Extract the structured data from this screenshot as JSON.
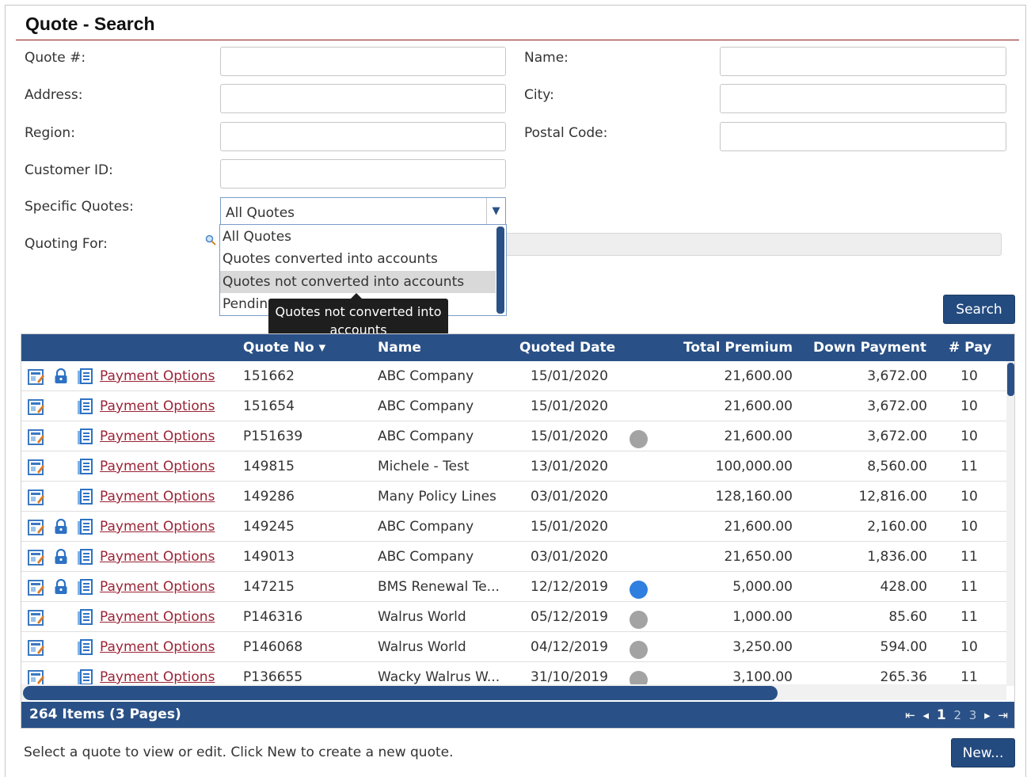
{
  "page": {
    "title": "Quote - Search"
  },
  "form": {
    "quote_no_label": "Quote #:",
    "name_label": "Name:",
    "address_label": "Address:",
    "city_label": "City:",
    "region_label": "Region:",
    "postal_code_label": "Postal Code:",
    "customer_id_label": "Customer ID:",
    "specific_quotes_label": "Specific Quotes:",
    "quoting_for_label": "Quoting For:",
    "specific_quotes_value": "All Quotes",
    "specific_quotes_options": [
      "All Quotes",
      "Quotes converted into accounts",
      "Quotes not converted into accounts",
      "Pending"
    ],
    "tooltip": "Quotes not converted into accounts",
    "search_label": "Search"
  },
  "grid": {
    "columns": {
      "quote_no": "Quote No",
      "name": "Name",
      "quoted_date": "Quoted Date",
      "total_premium": "Total Premium",
      "down_payment": "Down Payment",
      "pay": "# Pay"
    },
    "rows": [
      {
        "locked": true,
        "link": "Payment Options",
        "quote_no": "151662",
        "name": "ABC Company",
        "date": "15/01/2020",
        "status": "",
        "total": "21,600.00",
        "down": "3,672.00",
        "pay": "10"
      },
      {
        "locked": false,
        "link": "Payment Options",
        "quote_no": "151654",
        "name": "ABC Company",
        "date": "15/01/2020",
        "status": "",
        "total": "21,600.00",
        "down": "3,672.00",
        "pay": "10"
      },
      {
        "locked": false,
        "link": "Payment Options",
        "quote_no": "P151639",
        "name": "ABC Company",
        "date": "15/01/2020",
        "status": "grey",
        "total": "21,600.00",
        "down": "3,672.00",
        "pay": "10"
      },
      {
        "locked": false,
        "link": "Payment Options",
        "quote_no": "149815",
        "name": "Michele - Test",
        "date": "13/01/2020",
        "status": "",
        "total": "100,000.00",
        "down": "8,560.00",
        "pay": "11"
      },
      {
        "locked": false,
        "link": "Payment Options",
        "quote_no": "149286",
        "name": "Many Policy Lines",
        "date": "03/01/2020",
        "status": "",
        "total": "128,160.00",
        "down": "12,816.00",
        "pay": "10"
      },
      {
        "locked": true,
        "link": "Payment Options",
        "quote_no": "149245",
        "name": "ABC Company",
        "date": "15/01/2020",
        "status": "",
        "total": "21,600.00",
        "down": "2,160.00",
        "pay": "10"
      },
      {
        "locked": true,
        "link": "Payment Options",
        "quote_no": "149013",
        "name": "ABC Company",
        "date": "03/01/2020",
        "status": "",
        "total": "21,650.00",
        "down": "1,836.00",
        "pay": "11"
      },
      {
        "locked": true,
        "link": "Payment Options",
        "quote_no": "147215",
        "name": "BMS Renewal Te...",
        "date": "12/12/2019",
        "status": "blue",
        "total": "5,000.00",
        "down": "428.00",
        "pay": "11"
      },
      {
        "locked": false,
        "link": "Payment Options",
        "quote_no": "P146316",
        "name": "Walrus World",
        "date": "05/12/2019",
        "status": "grey",
        "total": "1,000.00",
        "down": "85.60",
        "pay": "11"
      },
      {
        "locked": false,
        "link": "Payment Options",
        "quote_no": "P146068",
        "name": "Walrus World",
        "date": "04/12/2019",
        "status": "grey",
        "total": "3,250.00",
        "down": "594.00",
        "pay": "10"
      },
      {
        "locked": false,
        "link": "Payment Options",
        "quote_no": "P136655",
        "name": "Wacky Walrus W...",
        "date": "31/10/2019",
        "status": "grey",
        "total": "3,100.00",
        "down": "265.36",
        "pay": "11"
      }
    ],
    "footer": {
      "count": "264 Items (3 Pages)",
      "pages": [
        "1",
        "2",
        "3"
      ],
      "current_page": "1"
    }
  },
  "hint": "Select a quote to view or edit. Click New to create a new quote.",
  "new_label": "New...",
  "colors": {
    "header": "#2a5187",
    "link": "#9b2335",
    "status_grey": "#a3a3a3",
    "status_blue": "#2f7fe0"
  },
  "icons": [
    "edit-icon",
    "lock-icon",
    "document-icon",
    "search-icon",
    "sort-down-icon",
    "first-page-icon",
    "prev-page-icon",
    "next-page-icon",
    "last-page-icon"
  ]
}
